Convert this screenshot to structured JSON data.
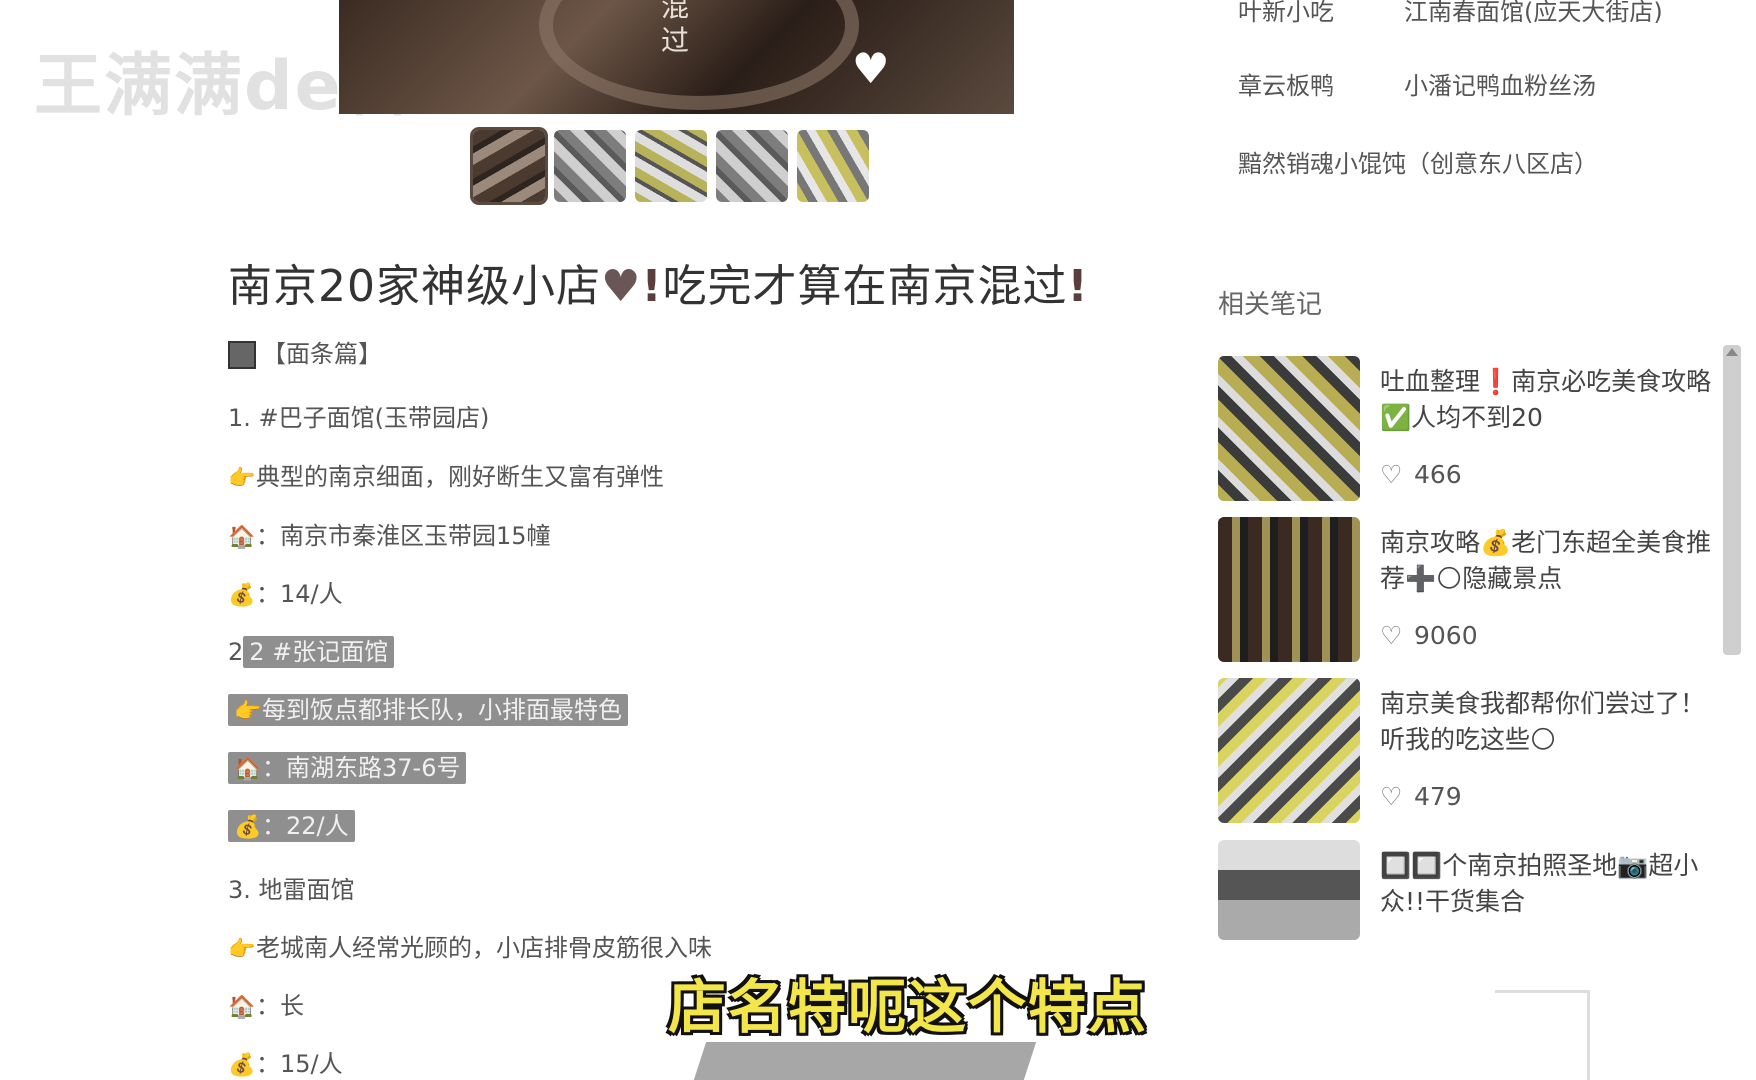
{
  "watermark": "王满满de料理",
  "hero": {
    "vertical_text": "混过"
  },
  "post": {
    "title_part1": "南京20家神级小店",
    "title_heart": "♥",
    "title_bang": "!",
    "title_part2": "吃完才算在南京混过",
    "section": "【面条篇】",
    "items": [
      {
        "name": "1. #巴子面馆(玉带园店)",
        "desc": "典型的南京细面，刚好断生又富有弹性",
        "addr": "：南京市秦淮区玉带园15幢",
        "price": "：14/人"
      },
      {
        "name": "2 #张记面馆",
        "desc": "每到饭点都排长队，小排面最特色",
        "addr": "：南湖东路37-6号",
        "price": "：22/人"
      },
      {
        "name": "3. 地雷面馆",
        "desc": "老城南人经常光顾的，小店排骨皮筋很入味",
        "addr": "：长",
        "price": "：15/人"
      }
    ]
  },
  "sidebar": {
    "shops": [
      "叶新小吃",
      "江南春面馆(应天大街店)",
      "章云板鸭",
      "小潘记鸭血粉丝汤",
      "黯然销魂小馄饨（创意东八区店）"
    ],
    "related_title": "相关笔记",
    "related": [
      {
        "title": "吐血整理❗南京必吃美食攻略✅人均不到20",
        "likes": "466"
      },
      {
        "title": "南京攻略💰老门东超全美食推荐➕🌕隐藏景点",
        "likes": "9060"
      },
      {
        "title": "南京美食我都帮你们尝过了！听我的吃这些🌕",
        "likes": "479"
      },
      {
        "title": "🔲🔲个南京拍照圣地📷超小众!!干货集合",
        "likes": ""
      }
    ]
  },
  "subtitle": "店名特呃这个特点",
  "icons": {
    "point": "pointing-hand-icon",
    "house": "house-icon",
    "money": "money-bag-icon",
    "like": "heart-outline-icon"
  }
}
